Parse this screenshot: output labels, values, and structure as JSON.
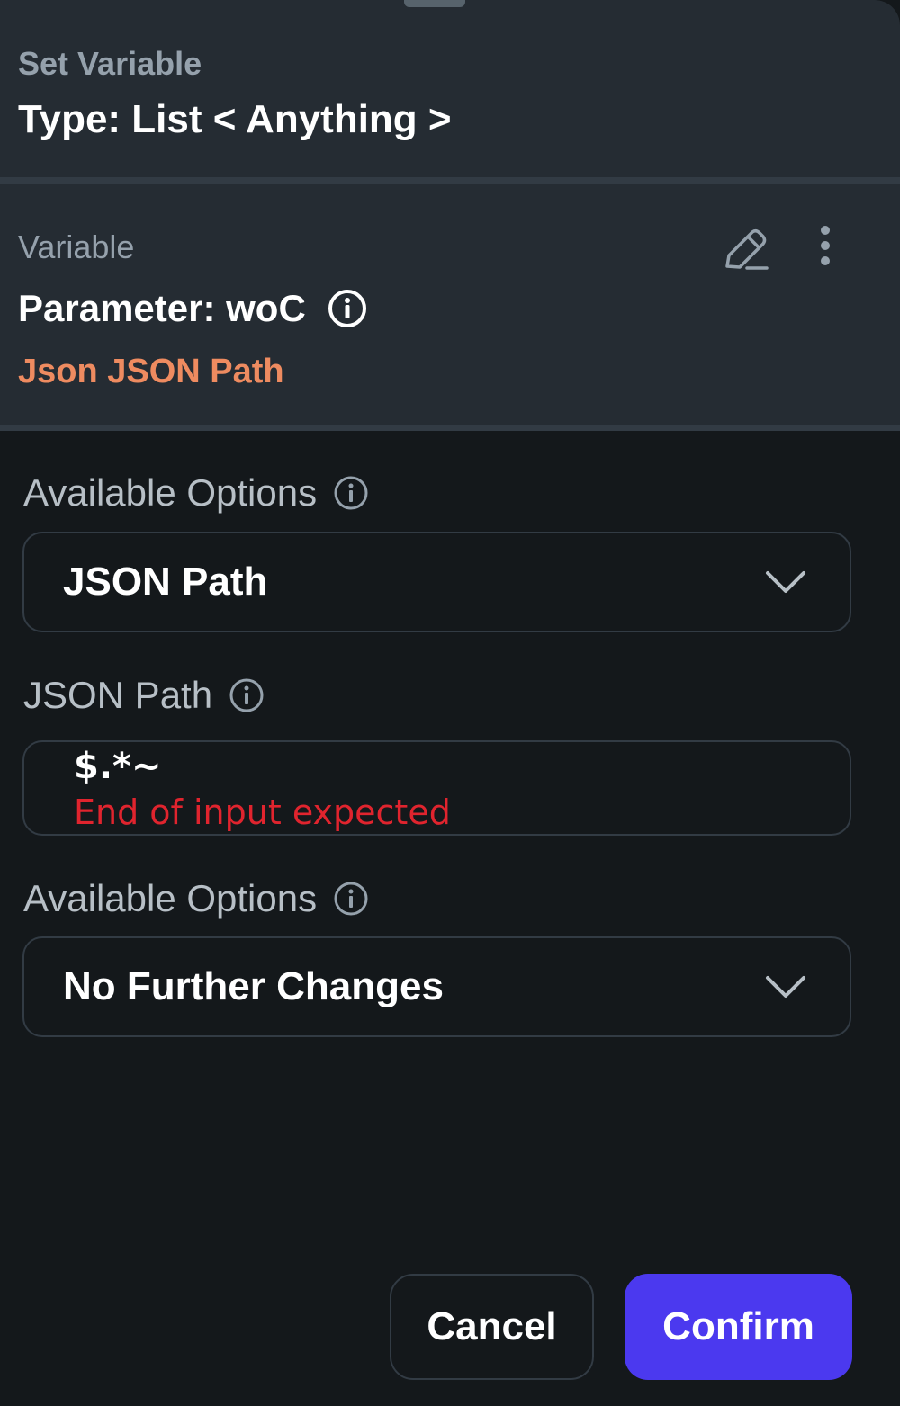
{
  "header": {
    "subtitle": "Set Variable",
    "title": "Type: List < Anything >"
  },
  "variable": {
    "label": "Variable",
    "parameter": "Parameter: woC",
    "path_summary": "Json JSON Path"
  },
  "source_options": {
    "label": "Available Options",
    "selected": "JSON Path"
  },
  "json_path": {
    "label": "JSON Path",
    "value": "$.*~",
    "error": "End of input expected"
  },
  "further_options": {
    "label": "Available Options",
    "selected": "No Further Changes"
  },
  "actions": {
    "cancel_label": "Cancel",
    "confirm_label": "Confirm"
  },
  "colors": {
    "background": "#14181b",
    "card": "#252c33",
    "accent": "#ee8b60",
    "error": "#e0242e",
    "primary": "#4b39ef"
  },
  "icons": {
    "edit": "pencil-icon",
    "more": "more-vertical-icon",
    "info": "info-icon",
    "dropdown": "chevron-down-icon"
  }
}
